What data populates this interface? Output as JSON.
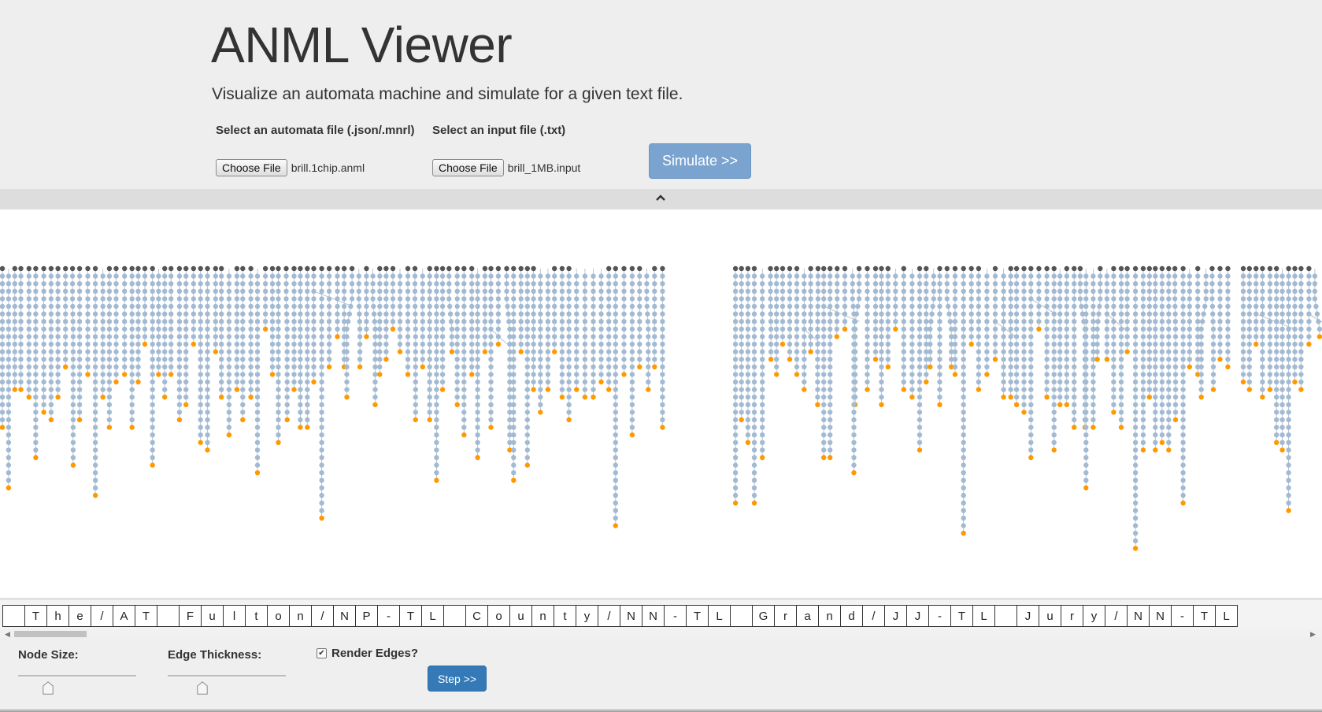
{
  "header": {
    "title": "ANML Viewer",
    "subtitle": "Visualize an automata machine and simulate for a given text file."
  },
  "automata_input": {
    "label": "Select an automata file (.json/.mnrl)",
    "button_label": "Choose File",
    "file_name": "brill.1chip.anml"
  },
  "text_input": {
    "label": "Select an input file (.txt)",
    "button_label": "Choose File",
    "file_name": "brill_1MB.input"
  },
  "simulate_button": "Simulate >>",
  "graph": {
    "colors": {
      "start_node": "#555555",
      "node": "#a3bad3",
      "report_node": "#ff9900",
      "edge": "#aab8c8",
      "background": "#ffffff"
    }
  },
  "tape": {
    "characters": [
      " ",
      "T",
      "h",
      "e",
      "/",
      "A",
      "T",
      " ",
      "F",
      "u",
      "l",
      "t",
      "o",
      "n",
      "/",
      "N",
      "P",
      "-",
      "T",
      "L",
      " ",
      "C",
      "o",
      "u",
      "n",
      "t",
      "y",
      "/",
      "N",
      "N",
      "-",
      "T",
      "L",
      " ",
      "G",
      "r",
      "a",
      "n",
      "d",
      "/",
      "J",
      "J",
      "-",
      "T",
      "L",
      " ",
      "J",
      "u",
      "r",
      "y",
      "/",
      "N",
      "N",
      "-",
      "T",
      "L"
    ]
  },
  "controls": {
    "node_size_label": "Node Size:",
    "edge_thickness_label": "Edge Thickness:",
    "node_size_value": 0.25,
    "edge_thickness_value": 0.29,
    "render_edges_label": "Render Edges?",
    "render_edges_checked": true,
    "step_button": "Step >>"
  }
}
